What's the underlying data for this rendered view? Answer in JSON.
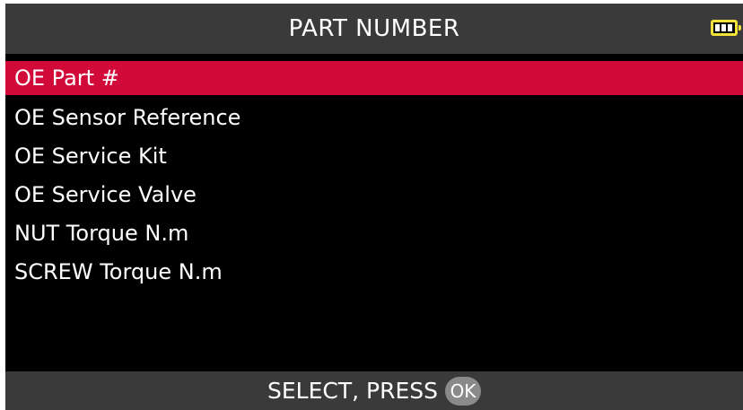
{
  "header": {
    "title": "PART NUMBER",
    "battery_icon": "battery-icon",
    "battery_color": "#f2e23a"
  },
  "menu": {
    "items": [
      {
        "label": "OE Part #",
        "selected": true
      },
      {
        "label": "OE Sensor Reference",
        "selected": false
      },
      {
        "label": "OE Service Kit",
        "selected": false
      },
      {
        "label": "OE Service Valve",
        "selected": false
      },
      {
        "label": "NUT Torque N.m",
        "selected": false
      },
      {
        "label": "SCREW Torque N.m",
        "selected": false
      }
    ],
    "selected_color": "#d10a3a"
  },
  "footer": {
    "prompt": "SELECT, PRESS",
    "ok_label": "OK"
  }
}
